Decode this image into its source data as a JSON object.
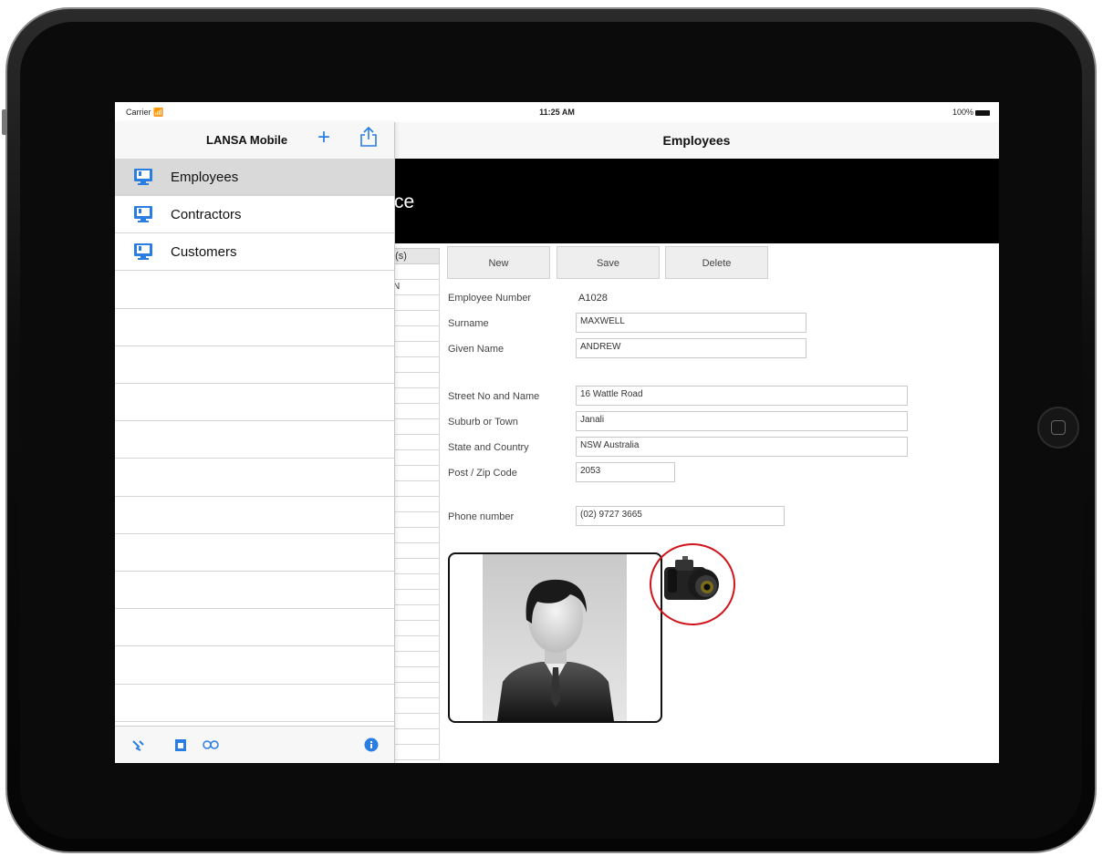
{
  "status_bar": {
    "carrier": "Carrier",
    "time": "11:25 AM",
    "battery": "100%"
  },
  "master": {
    "title": "LANSA Mobile",
    "items": [
      {
        "label": "Employees",
        "selected": true
      },
      {
        "label": "Contractors",
        "selected": false
      },
      {
        "label": "Customers",
        "selected": false
      }
    ],
    "empty_rows": 12,
    "toolbar_icons": [
      "wrench-icon",
      "calendar-icon",
      "link-icon",
      "info-icon"
    ]
  },
  "detail": {
    "title": "Employees",
    "banner_text": "ce",
    "grid": {
      "header": "n(s)",
      "first_cell": "N"
    },
    "buttons": {
      "new": "New",
      "save": "Save",
      "delete": "Delete"
    },
    "form": {
      "employee_number": {
        "label": "Employee Number",
        "value": "A1028"
      },
      "surname": {
        "label": "Surname",
        "value": "MAXWELL"
      },
      "given_name": {
        "label": "Given Name",
        "value": "ANDREW"
      },
      "street": {
        "label": "Street No and Name",
        "value": "16 Wattle Road"
      },
      "suburb": {
        "label": "Suburb or Town",
        "value": "Janali"
      },
      "state": {
        "label": "State and Country",
        "value": "NSW Australia"
      },
      "postcode": {
        "label": "Post / Zip Code",
        "value": "2053"
      },
      "phone": {
        "label": "Phone number",
        "value": "(02) 9727 3665"
      }
    }
  },
  "colors": {
    "accent": "#2a7de1",
    "highlight_circle": "#d0141a",
    "banner": "#000000",
    "selected_row": "#d9d9d9"
  }
}
